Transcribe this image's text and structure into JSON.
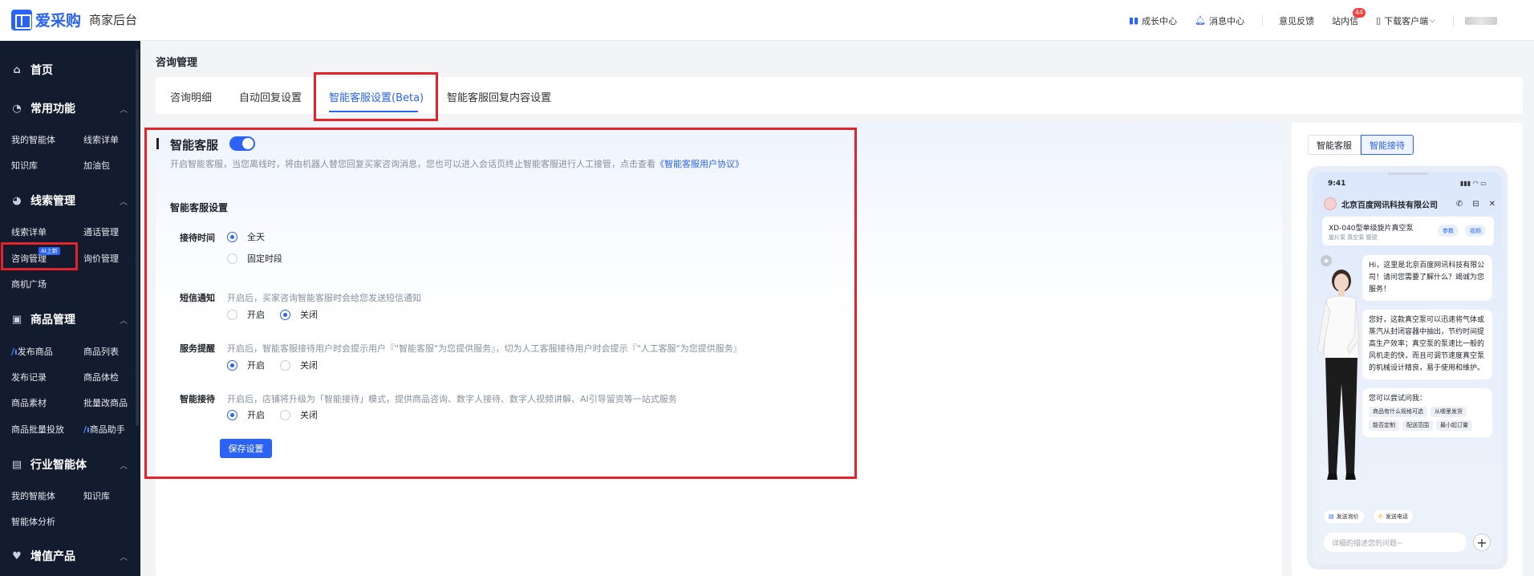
{
  "header": {
    "logo_text": "爱采购",
    "logo_sub": "商家后台",
    "items": [
      {
        "label": "成长中心",
        "icon": "growth-icon"
      },
      {
        "label": "消息中心",
        "icon": "bell-icon"
      },
      {
        "label": "意见反馈"
      },
      {
        "label": "站内信",
        "badge": "44"
      },
      {
        "label": "下载客户端",
        "icon": "phone-icon"
      }
    ]
  },
  "sidebar": {
    "home": "首页",
    "sections": [
      {
        "title": "常用功能",
        "links": [
          "我的智能体",
          "线索详单",
          "知识库",
          "加油包"
        ]
      },
      {
        "title": "线索管理",
        "links": [
          "线索详单",
          "通话管理",
          "咨询管理",
          "询价管理",
          "商机广场"
        ],
        "tag": "AI上新"
      },
      {
        "title": "商品管理",
        "links": [
          "发布商品",
          "商品列表",
          "发布记录",
          "商品体检",
          "商品素材",
          "批量改商品",
          "商品批量投放",
          "商品助手"
        ]
      },
      {
        "title": "行业智能体",
        "links": [
          "我的智能体",
          "知识库",
          "智能体分析"
        ]
      },
      {
        "title": "增值产品"
      }
    ]
  },
  "main": {
    "page_title": "咨询管理",
    "tabs": [
      "咨询明细",
      "自动回复设置",
      "智能客服设置(Beta)",
      "智能客服回复内容设置"
    ],
    "active_tab": 2,
    "section_title": "智能客服",
    "toggle_on": true,
    "description": "开启智能客服，当您离线时，将由机器人替您回复买家咨询消息，您也可以进入会话页终止智能客服进行人工接管，点击查看",
    "description_link": "《智能客服用户协议》",
    "settings_title": "智能客服设置",
    "reception_time": {
      "label": "接待时间",
      "options": [
        "全天",
        "固定时段"
      ],
      "selected": 0
    },
    "sms": {
      "label": "短信通知",
      "help": "开启后，买家咨询智能客服时会给您发送短信通知",
      "options": [
        "开启",
        "关闭"
      ],
      "selected": 1
    },
    "service_hint": {
      "label": "服务提醒",
      "help": "开启后，智能客服接待用户时会提示用户『\"智能客服\"为您提供服务』，切为人工客服接待用户时会提示『\"人工客服\"为您提供服务』",
      "options": [
        "开启",
        "关闭"
      ],
      "selected": 0
    },
    "smart_reception": {
      "label": "智能接待",
      "help": "开启后，店铺将升级为「智能接待」模式，提供商品咨询、数字人接待、数字人视频讲解、AI引导留资等一站式服务",
      "options": [
        "开启",
        "关闭"
      ],
      "selected": 0
    },
    "save_label": "保存设置"
  },
  "preview": {
    "tabs": [
      "智能客服",
      "智能接待"
    ],
    "active_tab": 1,
    "time": "9:41",
    "shop_name": "北京百度网讯科技有限公司",
    "product_name": "XD-040型单级旋片真空泵",
    "product_tags": "旋片泵  真空泵  镀锐",
    "product_btns": [
      "参数",
      "视频"
    ],
    "bubble1": "Hi，这里是北京百度网讯科技有限公司！请问您需要了解什么？竭诚为您服务！",
    "bubble2": "您好，这款真空泵可以迅速将气体或蒸汽从封闭容器中抽出，节约时间提高生产效率；真空泵的泵速比一般的风机走的快，而且可调节速度真空泵的机械设计精良，易于使用和维护。",
    "ask_title": "您可以尝试问我：",
    "chips": [
      "商品有什么规格可选",
      "从哪里发货",
      "能否定制",
      "配送范围",
      "最小起订量"
    ],
    "quick_actions": [
      "发送询价",
      "发送电话"
    ],
    "input_placeholder": "详细的描述您的问题~"
  }
}
